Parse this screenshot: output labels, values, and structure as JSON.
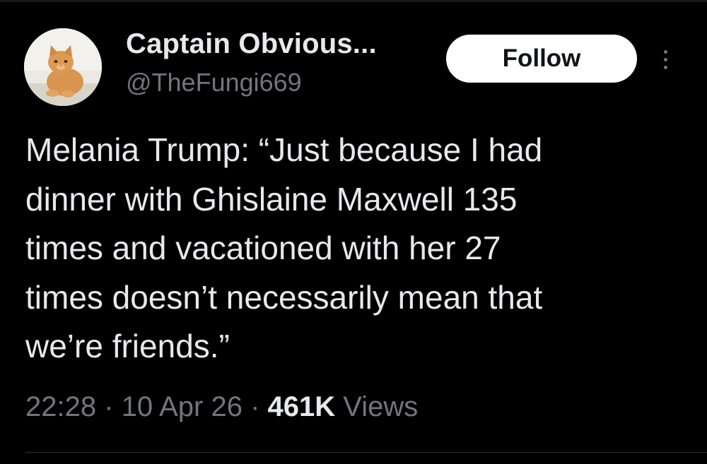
{
  "author": {
    "display_name": "Captain Obvious...",
    "handle": "@TheFungi669",
    "avatar_icon": "cat-avatar-icon"
  },
  "actions": {
    "follow_label": "Follow",
    "more_icon": "vertical-ellipsis-icon"
  },
  "tweet": {
    "lines": [
      "Melania Trump: “Just because I had",
      "dinner with Ghislaine Maxwell 135",
      "times and vacationed with her 27",
      "times doesn’t necessarily mean that",
      "we’re friends.”"
    ]
  },
  "meta": {
    "time": "22:28",
    "separator": "·",
    "date": "10 Apr 26",
    "views_count": "461K",
    "views_label": "Views"
  },
  "colors": {
    "background": "#000000",
    "primary_text": "#e7e9ea",
    "secondary_text": "#71767b",
    "follow_button_bg": "#ffffff",
    "follow_button_text": "#0f1419"
  }
}
